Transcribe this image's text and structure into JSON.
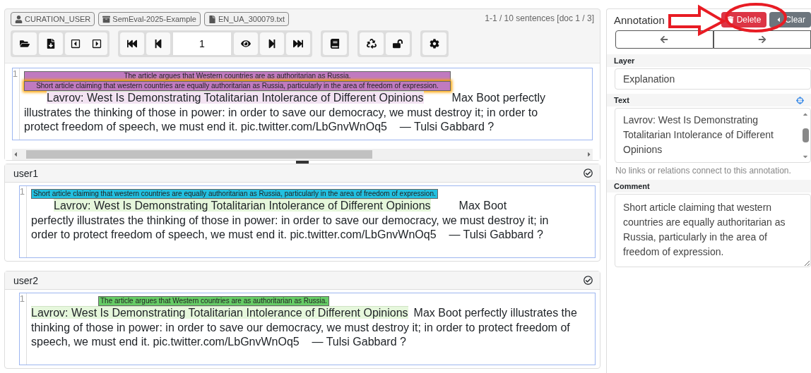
{
  "badges": [
    {
      "kind": "user",
      "label": "CURATION_USER"
    },
    {
      "kind": "project",
      "label": "SemEval-2025-Example"
    },
    {
      "kind": "document",
      "label": "EN_UA_300079.txt"
    }
  ],
  "page_field": {
    "value": "1"
  },
  "status": "1-1 / 10 sentences [doc 1 / 3]",
  "editor": {
    "line_number": "1",
    "labels": [
      {
        "text": "The article argues that Western countries are as authoritarian as Russia.",
        "color": "#c07ac0",
        "selected": false
      },
      {
        "text": "Short article claiming that western countries are equally authoritarian as Russia, particularly in the area of freedom of expression.",
        "color": "#c07ac0",
        "selected": true
      }
    ],
    "highlight": "Lavrov: West Is Demonstrating Totalitarian Intolerance of Different Opinions",
    "text": "Max Boot perfectly illustrates the thinking of those in power: in order to save our democracy, we must destroy it; in order to protect freedom of speech, we must end it. pic.twitter.com/LbGnvWnOq5    — Tulsi Gabbard ?"
  },
  "users": [
    {
      "name": "user1",
      "line_number": "1",
      "labels": [
        {
          "text": "Short article claiming that western countries are equally authoritarian as Russia, particularly in the area of freedom of expression.",
          "color": "#22c0e0"
        }
      ],
      "highlight": "Lavrov: West Is Demonstrating Totalitarian Intolerance of Different Opinions",
      "text": "Max Boot perfectly illustrates the thinking of those in power: in order to save our democracy, we must destroy it; in order to protect freedom of speech, we must end it. pic.twitter.com/LbGnvWnOq5    — Tulsi Gabbard ?"
    },
    {
      "name": "user2",
      "line_number": "1",
      "labels": [
        {
          "text": "The article argues that Western countries are as authoritarian as Russia.",
          "color": "#66cc66"
        }
      ],
      "highlight": "Lavrov: West Is Demonstrating Totalitarian Intolerance of Different Opinions",
      "text": "Max Boot perfectly illustrates the thinking of those in power: in order to save our democracy, we must destroy it; in order to protect freedom of speech, we must end it. pic.twitter.com/LbGnvWnOq5    — Tulsi Gabbard ?"
    }
  ],
  "sidebar": {
    "title": "Annotation",
    "delete_button": "Delete",
    "clear_button": "Clear",
    "layer_label": "Layer",
    "layer_value": "Explanation",
    "text_label": "Text",
    "text_value": "Lavrov: West Is Demonstrating Totalitarian Intolerance of Different Opinions",
    "note": "No links or relations connect to this annotation.",
    "comment_label": "Comment",
    "comment_value": "Short article claiming that western countries are equally authoritarian as Russia, particularly in the area of freedom of expression."
  }
}
